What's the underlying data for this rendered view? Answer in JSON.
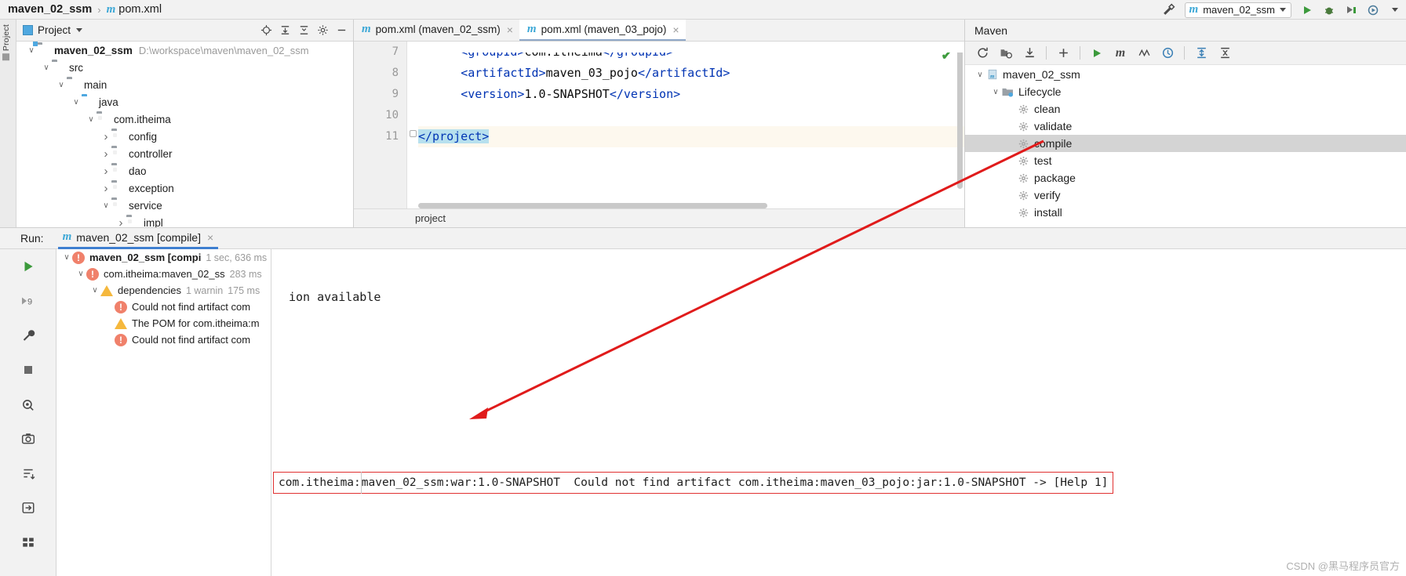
{
  "breadcrumb": {
    "project": "maven_02_ssm",
    "separator": "›",
    "file_icon": "maven-m-icon",
    "file": "pom.xml"
  },
  "toolbar_right": {
    "build_icon": "hammer-icon",
    "run_config": {
      "icon": "maven-m-icon",
      "name": "maven_02_ssm",
      "chevron": "chevron-down-icon"
    },
    "run_icon": "run-icon",
    "debug_icon": "debug-icon",
    "coverage_icon": "run-with-coverage-icon",
    "profile_icon": "profiler-icon",
    "more_icon": "chevron-down-icon"
  },
  "left_strip": {
    "label": "Project"
  },
  "project_panel": {
    "title": "Project",
    "chevron": "chevron-down-icon",
    "icons": [
      "target-icon",
      "collapse-to-selection-icon",
      "collapse-all-icon",
      "gear-icon",
      "hide-icon"
    ],
    "tree": [
      {
        "depth": 0,
        "arrow": "down",
        "icon": "module-folder",
        "label": "maven_02_ssm",
        "bold": true,
        "path": "D:\\workspace\\maven\\maven_02_ssm"
      },
      {
        "depth": 1,
        "arrow": "down",
        "icon": "folder",
        "label": "src",
        "bold": false,
        "path": ""
      },
      {
        "depth": 2,
        "arrow": "down",
        "icon": "folder",
        "label": "main",
        "bold": false,
        "path": ""
      },
      {
        "depth": 3,
        "arrow": "down",
        "icon": "folder-blue",
        "label": "java",
        "bold": false,
        "path": ""
      },
      {
        "depth": 4,
        "arrow": "down",
        "icon": "package",
        "label": "com.itheima",
        "bold": false,
        "path": ""
      },
      {
        "depth": 5,
        "arrow": "right",
        "icon": "package",
        "label": "config",
        "bold": false,
        "path": ""
      },
      {
        "depth": 5,
        "arrow": "right",
        "icon": "package",
        "label": "controller",
        "bold": false,
        "path": ""
      },
      {
        "depth": 5,
        "arrow": "right",
        "icon": "package",
        "label": "dao",
        "bold": false,
        "path": ""
      },
      {
        "depth": 5,
        "arrow": "right",
        "icon": "package",
        "label": "exception",
        "bold": false,
        "path": ""
      },
      {
        "depth": 5,
        "arrow": "down",
        "icon": "package",
        "label": "service",
        "bold": false,
        "path": ""
      },
      {
        "depth": 6,
        "arrow": "right",
        "icon": "package",
        "label": "impl",
        "bold": false,
        "path": ""
      }
    ]
  },
  "editor": {
    "tabs": [
      {
        "icon": "maven-m-icon",
        "label": "pom.xml (maven_02_ssm)",
        "active": false,
        "close": "×"
      },
      {
        "icon": "maven-m-icon",
        "label": "pom.xml (maven_03_pojo)",
        "active": true,
        "close": "×"
      }
    ],
    "line_numbers": [
      "7",
      "8",
      "9",
      "10",
      "11"
    ],
    "lines": [
      {
        "n": "7",
        "indent": "      ",
        "open": "<groupId>",
        "text": "com.itheima",
        "close": "</groupId>",
        "current": false,
        "clipped": true
      },
      {
        "n": "8",
        "indent": "      ",
        "open": "<artifactId>",
        "text": "maven_03_pojo",
        "close": "</artifactId>",
        "current": false,
        "clipped": false
      },
      {
        "n": "9",
        "indent": "      ",
        "open": "<version>",
        "text": "1.0-SNAPSHOT",
        "close": "</version>",
        "current": false,
        "clipped": false
      },
      {
        "n": "10",
        "indent": "",
        "open": "",
        "text": "",
        "close": "",
        "current": false,
        "clipped": false
      },
      {
        "n": "11",
        "indent": "",
        "open": "</project>",
        "text": "",
        "close": "",
        "current": true,
        "clipped": false
      }
    ],
    "selected_text": "</project>",
    "breadcrumb_bottom": "project",
    "inspection_status": "✔"
  },
  "maven_panel": {
    "title": "Maven",
    "toolbar_icons": [
      "reload-icon",
      "generate-sources-icon",
      "download-sources-icon",
      "add-icon",
      "run-icon",
      "execute-maven-goal-icon",
      "toggle-skip-tests-icon",
      "toggle-offline-icon",
      "expand-all-icon",
      "collapse-all-icon"
    ],
    "tree": [
      {
        "depth": 0,
        "arrow": "down",
        "icon": "maven-project-icon",
        "label": "maven_02_ssm",
        "selected": false
      },
      {
        "depth": 1,
        "arrow": "down",
        "icon": "lifecycle-folder-icon",
        "label": "Lifecycle",
        "selected": false
      },
      {
        "depth": 2,
        "arrow": "none",
        "icon": "gear-icon",
        "label": "clean",
        "selected": false
      },
      {
        "depth": 2,
        "arrow": "none",
        "icon": "gear-icon",
        "label": "validate",
        "selected": false
      },
      {
        "depth": 2,
        "arrow": "none",
        "icon": "gear-icon",
        "label": "compile",
        "selected": true
      },
      {
        "depth": 2,
        "arrow": "none",
        "icon": "gear-icon",
        "label": "test",
        "selected": false
      },
      {
        "depth": 2,
        "arrow": "none",
        "icon": "gear-icon",
        "label": "package",
        "selected": false
      },
      {
        "depth": 2,
        "arrow": "none",
        "icon": "gear-icon",
        "label": "verify",
        "selected": false
      },
      {
        "depth": 2,
        "arrow": "none",
        "icon": "gear-icon",
        "label": "install",
        "selected": false
      }
    ]
  },
  "run_window": {
    "label": "Run:",
    "tab": {
      "icon": "maven-m-icon",
      "label": "maven_02_ssm [compile]",
      "close": "×"
    },
    "sidebar_icons": [
      "rerun-icon",
      "rerun-failed-icon",
      "settings-wrench-icon",
      "stop-icon",
      "filter-icon",
      "screenshot-icon",
      "sort-icon",
      "export-icon",
      "layout-icon"
    ],
    "tree": [
      {
        "depth": 0,
        "arrow": "down",
        "status": "error",
        "label": "maven_02_ssm [compi",
        "time": "1 sec, 636 ms",
        "bold": true,
        "extra": ""
      },
      {
        "depth": 1,
        "arrow": "down",
        "status": "error",
        "label": "com.itheima:maven_02_ss",
        "time": "283 ms",
        "bold": false,
        "extra": ""
      },
      {
        "depth": 2,
        "arrow": "down",
        "status": "warning",
        "label": "dependencies",
        "time": "175 ms",
        "bold": false,
        "extra": "1 warnin"
      },
      {
        "depth": 3,
        "arrow": "none",
        "status": "error",
        "label": "Could not find artifact com",
        "time": "",
        "bold": false,
        "extra": ""
      },
      {
        "depth": 3,
        "arrow": "none",
        "status": "warning",
        "label": "The POM for com.itheima:m",
        "time": "",
        "bold": false,
        "extra": ""
      },
      {
        "depth": 3,
        "arrow": "none",
        "status": "error",
        "label": "Could not find artifact com",
        "time": "",
        "bold": false,
        "extra": ""
      }
    ],
    "console_text": "ion available",
    "error_box": {
      "prefix": "com.itheima:",
      "body": "maven_02_ssm:war:1.0-SNAPSHOT  Could not find artifact com.itheima:maven_03_pojo:jar:1.0-SNAPSHOT -> [Help 1]"
    }
  },
  "watermark": "CSDN @黑马程序员官方",
  "colors": {
    "accent_blue": "#3ba7d6",
    "selection_blue": "#b7e0ee",
    "tag_blue": "#0033b3",
    "error_red": "#e03030",
    "warn_orange": "#f5b83d",
    "error_orange": "#f0816b",
    "current_line": "#fdf8ee",
    "tree_selection": "#d4d4d4",
    "annotation_red": "#e01b1b"
  }
}
